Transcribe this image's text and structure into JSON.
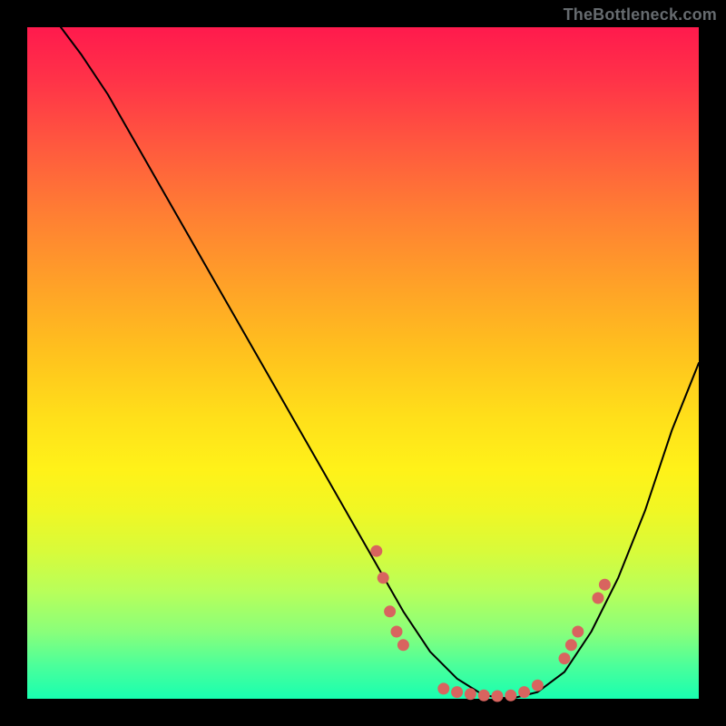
{
  "attribution": "TheBottleneck.com",
  "chart_data": {
    "type": "line",
    "title": "",
    "xlabel": "",
    "ylabel": "",
    "xlim": [
      0,
      100
    ],
    "ylim": [
      0,
      100
    ],
    "series": [
      {
        "name": "curve",
        "x": [
          5,
          8,
          12,
          16,
          20,
          24,
          28,
          32,
          36,
          40,
          44,
          48,
          52,
          56,
          60,
          64,
          68,
          72,
          76,
          80,
          84,
          88,
          92,
          96,
          100
        ],
        "y": [
          100,
          96,
          90,
          83,
          76,
          69,
          62,
          55,
          48,
          41,
          34,
          27,
          20,
          13,
          7,
          3,
          0.5,
          0,
          1,
          4,
          10,
          18,
          28,
          40,
          50
        ]
      }
    ],
    "points": [
      {
        "x": 52,
        "y": 22
      },
      {
        "x": 53,
        "y": 18
      },
      {
        "x": 54,
        "y": 13
      },
      {
        "x": 55,
        "y": 10
      },
      {
        "x": 56,
        "y": 8
      },
      {
        "x": 62,
        "y": 1.5
      },
      {
        "x": 64,
        "y": 1
      },
      {
        "x": 66,
        "y": 0.7
      },
      {
        "x": 68,
        "y": 0.5
      },
      {
        "x": 70,
        "y": 0.4
      },
      {
        "x": 72,
        "y": 0.5
      },
      {
        "x": 74,
        "y": 1
      },
      {
        "x": 76,
        "y": 2
      },
      {
        "x": 80,
        "y": 6
      },
      {
        "x": 81,
        "y": 8
      },
      {
        "x": 82,
        "y": 10
      },
      {
        "x": 85,
        "y": 15
      },
      {
        "x": 86,
        "y": 17
      }
    ]
  }
}
